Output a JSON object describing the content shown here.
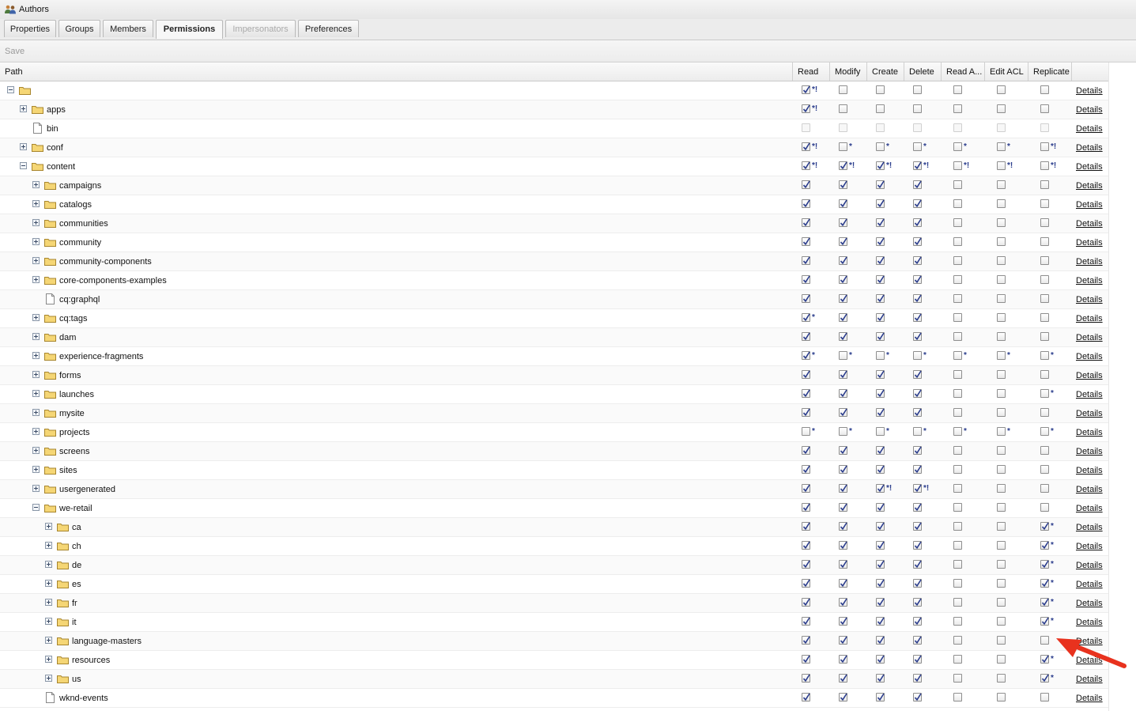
{
  "window": {
    "title": "Authors",
    "icon": "group-icon"
  },
  "tabs": [
    {
      "label": "Properties",
      "state": "normal"
    },
    {
      "label": "Groups",
      "state": "normal"
    },
    {
      "label": "Members",
      "state": "normal"
    },
    {
      "label": "Permissions",
      "state": "active"
    },
    {
      "label": "Impersonators",
      "state": "disabled"
    },
    {
      "label": "Preferences",
      "state": "normal"
    }
  ],
  "toolbar": {
    "save_label": "Save"
  },
  "columns": {
    "path": "Path",
    "read": "Read",
    "modify": "Modify",
    "create": "Create",
    "delete": "Delete",
    "read_acl": "Read A...",
    "edit_acl": "Edit ACL",
    "replicate": "Replicate"
  },
  "details_label": "Details",
  "rows": [
    {
      "name": "",
      "level": 0,
      "toggle": "minus",
      "icon": "folder",
      "perms": [
        [
          "c",
          "*!"
        ],
        [
          "u",
          ""
        ],
        [
          "u",
          ""
        ],
        [
          "u",
          ""
        ],
        [
          "u",
          ""
        ],
        [
          "u",
          ""
        ],
        [
          "u",
          ""
        ]
      ]
    },
    {
      "name": "apps",
      "level": 1,
      "toggle": "plus",
      "icon": "folder",
      "perms": [
        [
          "c",
          "*!"
        ],
        [
          "u",
          ""
        ],
        [
          "u",
          ""
        ],
        [
          "u",
          ""
        ],
        [
          "u",
          ""
        ],
        [
          "u",
          ""
        ],
        [
          "u",
          ""
        ]
      ]
    },
    {
      "name": "bin",
      "level": 1,
      "toggle": "",
      "icon": "file",
      "perms": [
        [
          "d",
          ""
        ],
        [
          "d",
          ""
        ],
        [
          "d",
          ""
        ],
        [
          "d",
          ""
        ],
        [
          "d",
          ""
        ],
        [
          "d",
          ""
        ],
        [
          "d",
          ""
        ]
      ]
    },
    {
      "name": "conf",
      "level": 1,
      "toggle": "plus",
      "icon": "folder",
      "perms": [
        [
          "c",
          "*!"
        ],
        [
          "u",
          "*"
        ],
        [
          "u",
          "*"
        ],
        [
          "u",
          "*"
        ],
        [
          "u",
          "*"
        ],
        [
          "u",
          "*"
        ],
        [
          "u",
          "*!"
        ]
      ]
    },
    {
      "name": "content",
      "level": 1,
      "toggle": "minus",
      "icon": "folder",
      "perms": [
        [
          "c",
          "*!"
        ],
        [
          "c",
          "*!"
        ],
        [
          "c",
          "*!"
        ],
        [
          "c",
          "*!"
        ],
        [
          "u",
          "*!"
        ],
        [
          "u",
          "*!"
        ],
        [
          "u",
          "*!"
        ]
      ]
    },
    {
      "name": "campaigns",
      "level": 2,
      "toggle": "plus",
      "icon": "folder",
      "perms": [
        [
          "c",
          ""
        ],
        [
          "c",
          ""
        ],
        [
          "c",
          ""
        ],
        [
          "c",
          ""
        ],
        [
          "u",
          ""
        ],
        [
          "u",
          ""
        ],
        [
          "u",
          ""
        ]
      ]
    },
    {
      "name": "catalogs",
      "level": 2,
      "toggle": "plus",
      "icon": "folder",
      "perms": [
        [
          "c",
          ""
        ],
        [
          "c",
          ""
        ],
        [
          "c",
          ""
        ],
        [
          "c",
          ""
        ],
        [
          "u",
          ""
        ],
        [
          "u",
          ""
        ],
        [
          "u",
          ""
        ]
      ]
    },
    {
      "name": "communities",
      "level": 2,
      "toggle": "plus",
      "icon": "folder",
      "perms": [
        [
          "c",
          ""
        ],
        [
          "c",
          ""
        ],
        [
          "c",
          ""
        ],
        [
          "c",
          ""
        ],
        [
          "u",
          ""
        ],
        [
          "u",
          ""
        ],
        [
          "u",
          ""
        ]
      ]
    },
    {
      "name": "community",
      "level": 2,
      "toggle": "plus",
      "icon": "folder",
      "perms": [
        [
          "c",
          ""
        ],
        [
          "c",
          ""
        ],
        [
          "c",
          ""
        ],
        [
          "c",
          ""
        ],
        [
          "u",
          ""
        ],
        [
          "u",
          ""
        ],
        [
          "u",
          ""
        ]
      ]
    },
    {
      "name": "community-components",
      "level": 2,
      "toggle": "plus",
      "icon": "folder",
      "perms": [
        [
          "c",
          ""
        ],
        [
          "c",
          ""
        ],
        [
          "c",
          ""
        ],
        [
          "c",
          ""
        ],
        [
          "u",
          ""
        ],
        [
          "u",
          ""
        ],
        [
          "u",
          ""
        ]
      ]
    },
    {
      "name": "core-components-examples",
      "level": 2,
      "toggle": "plus",
      "icon": "folder",
      "perms": [
        [
          "c",
          ""
        ],
        [
          "c",
          ""
        ],
        [
          "c",
          ""
        ],
        [
          "c",
          ""
        ],
        [
          "u",
          ""
        ],
        [
          "u",
          ""
        ],
        [
          "u",
          ""
        ]
      ]
    },
    {
      "name": "cq:graphql",
      "level": 2,
      "toggle": "",
      "icon": "file",
      "perms": [
        [
          "c",
          ""
        ],
        [
          "c",
          ""
        ],
        [
          "c",
          ""
        ],
        [
          "c",
          ""
        ],
        [
          "u",
          ""
        ],
        [
          "u",
          ""
        ],
        [
          "u",
          ""
        ]
      ]
    },
    {
      "name": "cq:tags",
      "level": 2,
      "toggle": "plus",
      "icon": "folder",
      "perms": [
        [
          "c",
          "*"
        ],
        [
          "c",
          ""
        ],
        [
          "c",
          ""
        ],
        [
          "c",
          ""
        ],
        [
          "u",
          ""
        ],
        [
          "u",
          ""
        ],
        [
          "u",
          ""
        ]
      ]
    },
    {
      "name": "dam",
      "level": 2,
      "toggle": "plus",
      "icon": "folder",
      "perms": [
        [
          "c",
          ""
        ],
        [
          "c",
          ""
        ],
        [
          "c",
          ""
        ],
        [
          "c",
          ""
        ],
        [
          "u",
          ""
        ],
        [
          "u",
          ""
        ],
        [
          "u",
          ""
        ]
      ]
    },
    {
      "name": "experience-fragments",
      "level": 2,
      "toggle": "plus",
      "icon": "folder",
      "perms": [
        [
          "c",
          "*"
        ],
        [
          "u",
          "*"
        ],
        [
          "u",
          "*"
        ],
        [
          "u",
          "*"
        ],
        [
          "u",
          "*"
        ],
        [
          "u",
          "*"
        ],
        [
          "u",
          "*"
        ]
      ]
    },
    {
      "name": "forms",
      "level": 2,
      "toggle": "plus",
      "icon": "folder",
      "perms": [
        [
          "c",
          ""
        ],
        [
          "c",
          ""
        ],
        [
          "c",
          ""
        ],
        [
          "c",
          ""
        ],
        [
          "u",
          ""
        ],
        [
          "u",
          ""
        ],
        [
          "u",
          ""
        ]
      ]
    },
    {
      "name": "launches",
      "level": 2,
      "toggle": "plus",
      "icon": "folder",
      "perms": [
        [
          "c",
          ""
        ],
        [
          "c",
          ""
        ],
        [
          "c",
          ""
        ],
        [
          "c",
          ""
        ],
        [
          "u",
          ""
        ],
        [
          "u",
          ""
        ],
        [
          "u",
          "*"
        ]
      ]
    },
    {
      "name": "mysite",
      "level": 2,
      "toggle": "plus",
      "icon": "folder",
      "perms": [
        [
          "c",
          ""
        ],
        [
          "c",
          ""
        ],
        [
          "c",
          ""
        ],
        [
          "c",
          ""
        ],
        [
          "u",
          ""
        ],
        [
          "u",
          ""
        ],
        [
          "u",
          ""
        ]
      ]
    },
    {
      "name": "projects",
      "level": 2,
      "toggle": "plus",
      "icon": "folder",
      "perms": [
        [
          "u",
          "*"
        ],
        [
          "u",
          "*"
        ],
        [
          "u",
          "*"
        ],
        [
          "u",
          "*"
        ],
        [
          "u",
          "*"
        ],
        [
          "u",
          "*"
        ],
        [
          "u",
          "*"
        ]
      ]
    },
    {
      "name": "screens",
      "level": 2,
      "toggle": "plus",
      "icon": "folder",
      "perms": [
        [
          "c",
          ""
        ],
        [
          "c",
          ""
        ],
        [
          "c",
          ""
        ],
        [
          "c",
          ""
        ],
        [
          "u",
          ""
        ],
        [
          "u",
          ""
        ],
        [
          "u",
          ""
        ]
      ]
    },
    {
      "name": "sites",
      "level": 2,
      "toggle": "plus",
      "icon": "folder",
      "perms": [
        [
          "c",
          ""
        ],
        [
          "c",
          ""
        ],
        [
          "c",
          ""
        ],
        [
          "c",
          ""
        ],
        [
          "u",
          ""
        ],
        [
          "u",
          ""
        ],
        [
          "u",
          ""
        ]
      ]
    },
    {
      "name": "usergenerated",
      "level": 2,
      "toggle": "plus",
      "icon": "folder",
      "perms": [
        [
          "c",
          ""
        ],
        [
          "c",
          ""
        ],
        [
          "c",
          "*!"
        ],
        [
          "c",
          "*!"
        ],
        [
          "u",
          ""
        ],
        [
          "u",
          ""
        ],
        [
          "u",
          ""
        ]
      ]
    },
    {
      "name": "we-retail",
      "level": 2,
      "toggle": "minus",
      "icon": "folder",
      "perms": [
        [
          "c",
          ""
        ],
        [
          "c",
          ""
        ],
        [
          "c",
          ""
        ],
        [
          "c",
          ""
        ],
        [
          "u",
          ""
        ],
        [
          "u",
          ""
        ],
        [
          "u",
          ""
        ]
      ]
    },
    {
      "name": "ca",
      "level": 3,
      "toggle": "plus",
      "icon": "folder",
      "perms": [
        [
          "c",
          ""
        ],
        [
          "c",
          ""
        ],
        [
          "c",
          ""
        ],
        [
          "c",
          ""
        ],
        [
          "u",
          ""
        ],
        [
          "u",
          ""
        ],
        [
          "c",
          "*"
        ]
      ]
    },
    {
      "name": "ch",
      "level": 3,
      "toggle": "plus",
      "icon": "folder",
      "perms": [
        [
          "c",
          ""
        ],
        [
          "c",
          ""
        ],
        [
          "c",
          ""
        ],
        [
          "c",
          ""
        ],
        [
          "u",
          ""
        ],
        [
          "u",
          ""
        ],
        [
          "c",
          "*"
        ]
      ]
    },
    {
      "name": "de",
      "level": 3,
      "toggle": "plus",
      "icon": "folder",
      "perms": [
        [
          "c",
          ""
        ],
        [
          "c",
          ""
        ],
        [
          "c",
          ""
        ],
        [
          "c",
          ""
        ],
        [
          "u",
          ""
        ],
        [
          "u",
          ""
        ],
        [
          "c",
          "*"
        ]
      ]
    },
    {
      "name": "es",
      "level": 3,
      "toggle": "plus",
      "icon": "folder",
      "perms": [
        [
          "c",
          ""
        ],
        [
          "c",
          ""
        ],
        [
          "c",
          ""
        ],
        [
          "c",
          ""
        ],
        [
          "u",
          ""
        ],
        [
          "u",
          ""
        ],
        [
          "c",
          "*"
        ]
      ]
    },
    {
      "name": "fr",
      "level": 3,
      "toggle": "plus",
      "icon": "folder",
      "perms": [
        [
          "c",
          ""
        ],
        [
          "c",
          ""
        ],
        [
          "c",
          ""
        ],
        [
          "c",
          ""
        ],
        [
          "u",
          ""
        ],
        [
          "u",
          ""
        ],
        [
          "c",
          "*"
        ]
      ]
    },
    {
      "name": "it",
      "level": 3,
      "toggle": "plus",
      "icon": "folder",
      "perms": [
        [
          "c",
          ""
        ],
        [
          "c",
          ""
        ],
        [
          "c",
          ""
        ],
        [
          "c",
          ""
        ],
        [
          "u",
          ""
        ],
        [
          "u",
          ""
        ],
        [
          "c",
          "*"
        ]
      ]
    },
    {
      "name": "language-masters",
      "level": 3,
      "toggle": "plus",
      "icon": "folder",
      "perms": [
        [
          "c",
          ""
        ],
        [
          "c",
          ""
        ],
        [
          "c",
          ""
        ],
        [
          "c",
          ""
        ],
        [
          "u",
          ""
        ],
        [
          "u",
          ""
        ],
        [
          "u",
          ""
        ]
      ]
    },
    {
      "name": "resources",
      "level": 3,
      "toggle": "plus",
      "icon": "folder",
      "perms": [
        [
          "c",
          ""
        ],
        [
          "c",
          ""
        ],
        [
          "c",
          ""
        ],
        [
          "c",
          ""
        ],
        [
          "u",
          ""
        ],
        [
          "u",
          ""
        ],
        [
          "c",
          "*"
        ]
      ]
    },
    {
      "name": "us",
      "level": 3,
      "toggle": "plus",
      "icon": "folder",
      "perms": [
        [
          "c",
          ""
        ],
        [
          "c",
          ""
        ],
        [
          "c",
          ""
        ],
        [
          "c",
          ""
        ],
        [
          "u",
          ""
        ],
        [
          "u",
          ""
        ],
        [
          "c",
          "*"
        ]
      ]
    },
    {
      "name": "wknd-events",
      "level": 2,
      "toggle": "",
      "icon": "file",
      "perms": [
        [
          "c",
          ""
        ],
        [
          "c",
          ""
        ],
        [
          "c",
          ""
        ],
        [
          "c",
          ""
        ],
        [
          "u",
          ""
        ],
        [
          "u",
          ""
        ],
        [
          "u",
          ""
        ]
      ]
    }
  ],
  "colors": {
    "arrow": "#e8321e",
    "check": "#2a3c8c",
    "folder": "#f5d675"
  }
}
